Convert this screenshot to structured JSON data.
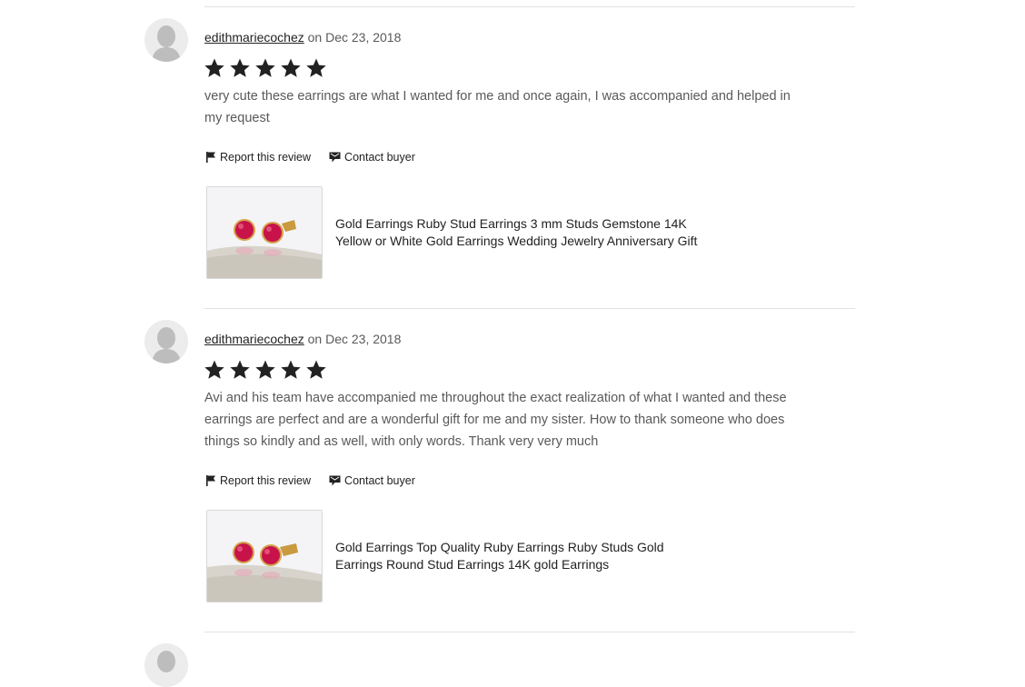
{
  "colors": {
    "star": "#222222",
    "divider": "#e1e3df",
    "ruby": "#c8124a",
    "gold": "#d3a34a"
  },
  "reviews": [
    {
      "username": "edithmariecochez",
      "date_text": "on Dec 23, 2018",
      "rating": 5,
      "text": "very cute these earrings are what I wanted for me and once again, I was accompanied and helped in my request",
      "report_label": "Report this review",
      "contact_label": "Contact buyer",
      "listing_title": "Gold Earrings Ruby Stud Earrings 3 mm Studs Gemstone 14K Yellow or White Gold Earrings Wedding Jewelry Anniversary Gift"
    },
    {
      "username": "edithmariecochez",
      "date_text": "on Dec 23, 2018",
      "rating": 5,
      "text": "Avi and his team have accompanied me throughout the exact realization of what I wanted and these earrings are perfect and are a wonderful gift for me and my sister. How to thank someone who does things so kindly and as well, with only words. Thank very very much",
      "report_label": "Report this review",
      "contact_label": "Contact buyer",
      "listing_title": "Gold Earrings Top Quality Ruby Earrings Ruby Studs Gold Earrings Round Stud Earrings 14K gold Earrings"
    }
  ]
}
